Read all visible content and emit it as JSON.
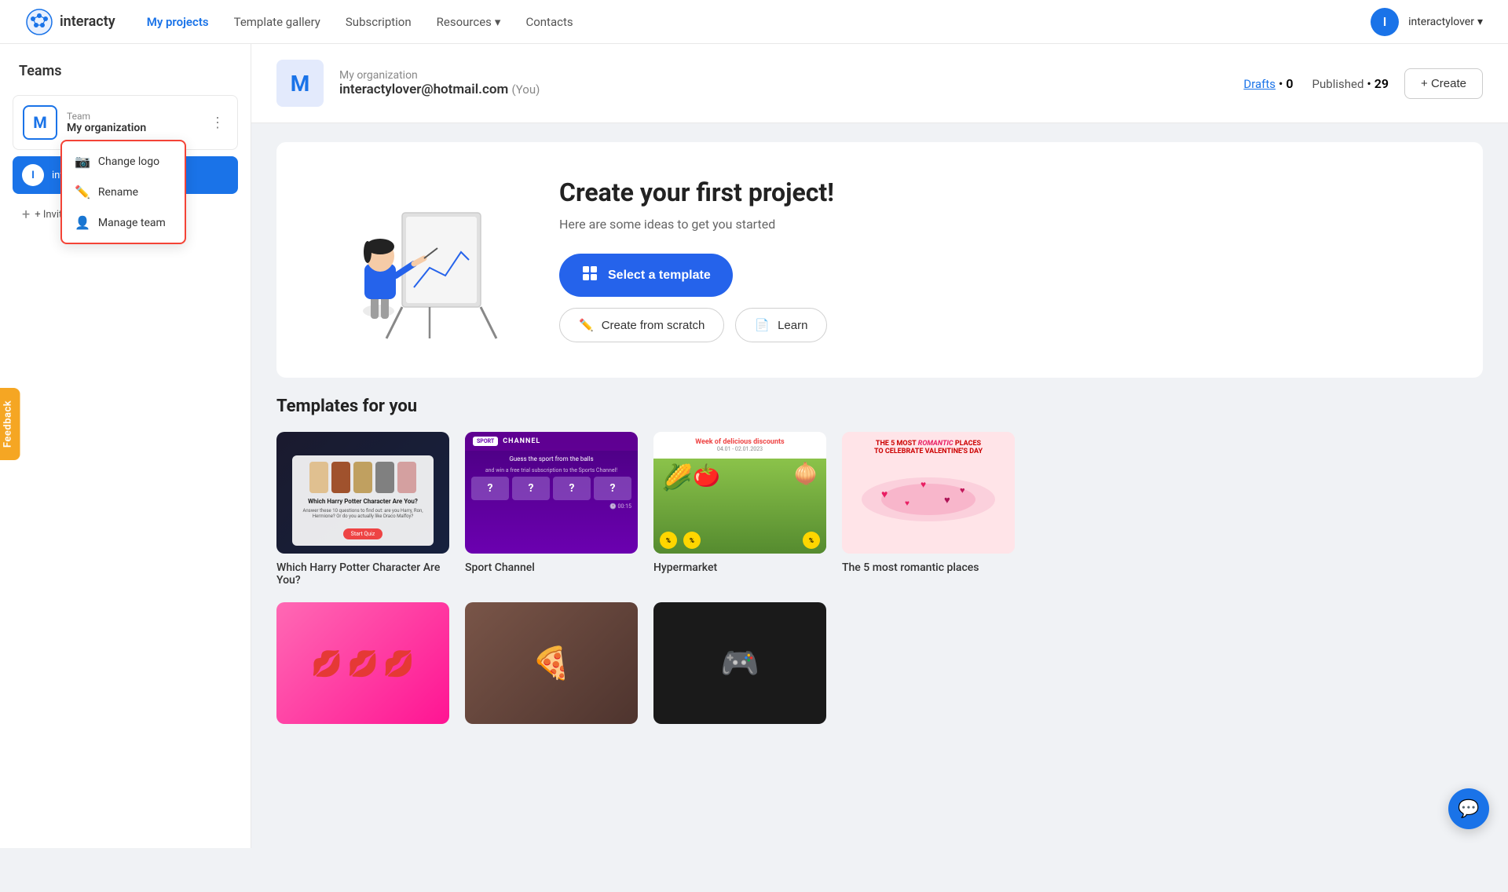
{
  "navbar": {
    "logo_text": "interacty",
    "links": [
      {
        "label": "My projects",
        "active": true
      },
      {
        "label": "Template gallery",
        "active": false
      },
      {
        "label": "Subscription",
        "active": false
      },
      {
        "label": "Resources",
        "active": false,
        "has_dropdown": true
      },
      {
        "label": "Contacts",
        "active": false
      }
    ],
    "user_initial": "I",
    "user_name": "interactylover",
    "user_dropdown_arrow": "▾"
  },
  "sidebar": {
    "title": "Teams",
    "team": {
      "avatar_letter": "M",
      "label": "Team",
      "name": "My organization",
      "dots": "⋮"
    },
    "member": {
      "initial": "I",
      "email": "interactylover@hotmail.co..."
    },
    "invite_label": "+ Invite members"
  },
  "context_menu": {
    "items": [
      {
        "icon": "📷",
        "label": "Change logo"
      },
      {
        "icon": "✏️",
        "label": "Rename"
      },
      {
        "icon": "👤",
        "label": "Manage team"
      }
    ]
  },
  "org_header": {
    "avatar_letter": "M",
    "org_name": "My organization",
    "email": "interactylover@hotmail.com",
    "you_label": "(You)",
    "drafts_label": "Drafts",
    "drafts_bullet": "•",
    "drafts_count": "0",
    "published_label": "Published",
    "published_bullet": "•",
    "published_count": "29",
    "create_label": "+ Create"
  },
  "hero": {
    "title": "Create your first project!",
    "subtitle": "Here are some ideas to get you started",
    "btn_select_template": "Select a template",
    "btn_create_scratch": "Create from scratch",
    "btn_learn": "Learn"
  },
  "templates_section": {
    "title": "Templates for you",
    "cards": [
      {
        "label": "Which Harry Potter Character Are You?"
      },
      {
        "label": "Sport Channel"
      },
      {
        "label": "Hypermarket"
      },
      {
        "label": "The 5 most romantic places"
      }
    ],
    "bottom_cards": [
      {
        "label": ""
      },
      {
        "label": ""
      },
      {
        "label": ""
      }
    ]
  },
  "feedback": {
    "label": "Feedback"
  }
}
